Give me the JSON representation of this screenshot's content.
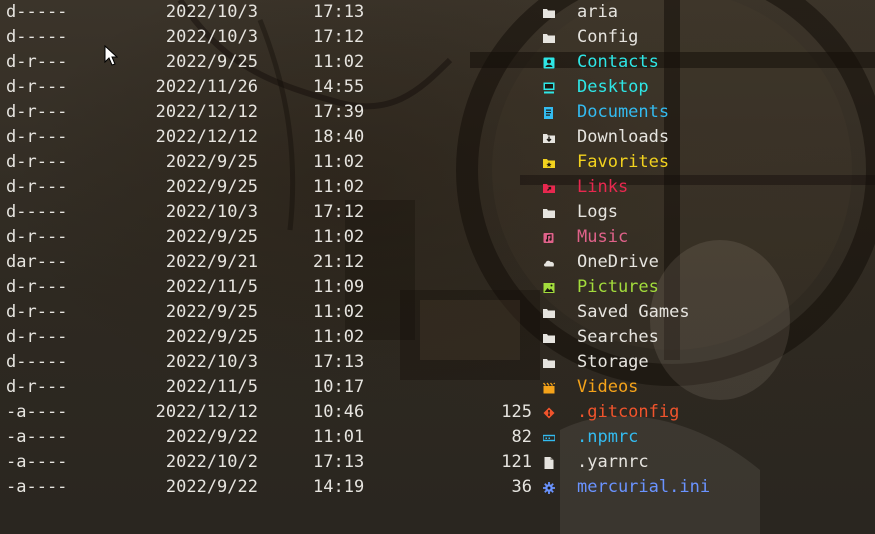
{
  "listing": [
    {
      "mode": "d-----",
      "date": "2022/10/3",
      "time": "17:13",
      "length": "",
      "name": "aria",
      "icon": "folder-icon",
      "color": "#e6e4df"
    },
    {
      "mode": "d-----",
      "date": "2022/10/3",
      "time": "17:12",
      "length": "",
      "name": "Config",
      "icon": "folder-icon",
      "color": "#e6e4df"
    },
    {
      "mode": "d-r---",
      "date": "2022/9/25",
      "time": "11:02",
      "length": "",
      "name": "Contacts",
      "icon": "contacts-icon",
      "color": "#2ee6e6"
    },
    {
      "mode": "d-r---",
      "date": "2022/11/26",
      "time": "14:55",
      "length": "",
      "name": "Desktop",
      "icon": "desktop-icon",
      "color": "#2ee6e6"
    },
    {
      "mode": "d-r---",
      "date": "2022/12/12",
      "time": "17:39",
      "length": "",
      "name": "Documents",
      "icon": "documents-icon",
      "color": "#33bbf0"
    },
    {
      "mode": "d-r---",
      "date": "2022/12/12",
      "time": "18:40",
      "length": "",
      "name": "Downloads",
      "icon": "download-icon",
      "color": "#e6e4df"
    },
    {
      "mode": "d-r---",
      "date": "2022/9/25",
      "time": "11:02",
      "length": "",
      "name": "Favorites",
      "icon": "star-folder-icon",
      "color": "#f2d21e"
    },
    {
      "mode": "d-r---",
      "date": "2022/9/25",
      "time": "11:02",
      "length": "",
      "name": "Links",
      "icon": "link-icon",
      "color": "#e8284f"
    },
    {
      "mode": "d-----",
      "date": "2022/10/3",
      "time": "17:12",
      "length": "",
      "name": "Logs",
      "icon": "folder-icon",
      "color": "#e6e4df"
    },
    {
      "mode": "d-r---",
      "date": "2022/9/25",
      "time": "11:02",
      "length": "",
      "name": "Music",
      "icon": "music-icon",
      "color": "#e0628a"
    },
    {
      "mode": "dar---",
      "date": "2022/9/21",
      "time": "21:12",
      "length": "",
      "name": "OneDrive",
      "icon": "cloud-icon",
      "color": "#e6e4df"
    },
    {
      "mode": "d-r---",
      "date": "2022/11/5",
      "time": "11:09",
      "length": "",
      "name": "Pictures",
      "icon": "picture-icon",
      "color": "#a2dc3c"
    },
    {
      "mode": "d-r---",
      "date": "2022/9/25",
      "time": "11:02",
      "length": "",
      "name": "Saved Games",
      "icon": "folder-icon",
      "color": "#e6e4df"
    },
    {
      "mode": "d-r---",
      "date": "2022/9/25",
      "time": "11:02",
      "length": "",
      "name": "Searches",
      "icon": "folder-icon",
      "color": "#e6e4df"
    },
    {
      "mode": "d-----",
      "date": "2022/10/3",
      "time": "17:13",
      "length": "",
      "name": "Storage",
      "icon": "folder-icon",
      "color": "#e6e4df"
    },
    {
      "mode": "d-r---",
      "date": "2022/11/5",
      "time": "10:17",
      "length": "",
      "name": "Videos",
      "icon": "video-icon",
      "color": "#f5a31a"
    },
    {
      "mode": "-a----",
      "date": "2022/12/12",
      "time": "10:46",
      "length": "125",
      "name": ".gitconfig",
      "icon": "git-icon",
      "color": "#f0542c"
    },
    {
      "mode": "-a----",
      "date": "2022/9/22",
      "time": "11:01",
      "length": "82",
      "name": ".npmrc",
      "icon": "npm-icon",
      "color": "#33bbf0"
    },
    {
      "mode": "-a----",
      "date": "2022/10/2",
      "time": "17:13",
      "length": "121",
      "name": ".yarnrc",
      "icon": "file-icon",
      "color": "#e6e4df"
    },
    {
      "mode": "-a----",
      "date": "2022/9/22",
      "time": "14:19",
      "length": "36",
      "name": "mercurial.ini",
      "icon": "gear-icon",
      "color": "#6a93ff"
    }
  ]
}
